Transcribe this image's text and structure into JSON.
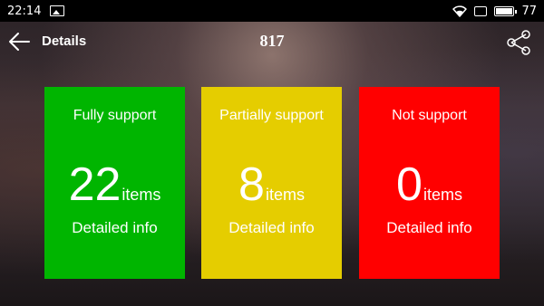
{
  "status_bar": {
    "time": "22:14",
    "battery_level": "77",
    "icons": [
      "image-icon",
      "wifi-icon",
      "screen-icon",
      "battery-icon"
    ]
  },
  "header": {
    "back_icon": "back-arrow-icon",
    "title": "Details",
    "center_title": "817",
    "share_icon": "share-icon"
  },
  "cards": [
    {
      "label": "Fully support",
      "count": "22",
      "unit": "items",
      "info": "Detailed info",
      "color": "#00b500"
    },
    {
      "label": "Partially support",
      "count": "8",
      "unit": "items",
      "info": "Detailed info",
      "color": "#e5cd00"
    },
    {
      "label": "Not support",
      "count": "0",
      "unit": "items",
      "info": "Detailed info",
      "color": "#ff0000"
    }
  ]
}
